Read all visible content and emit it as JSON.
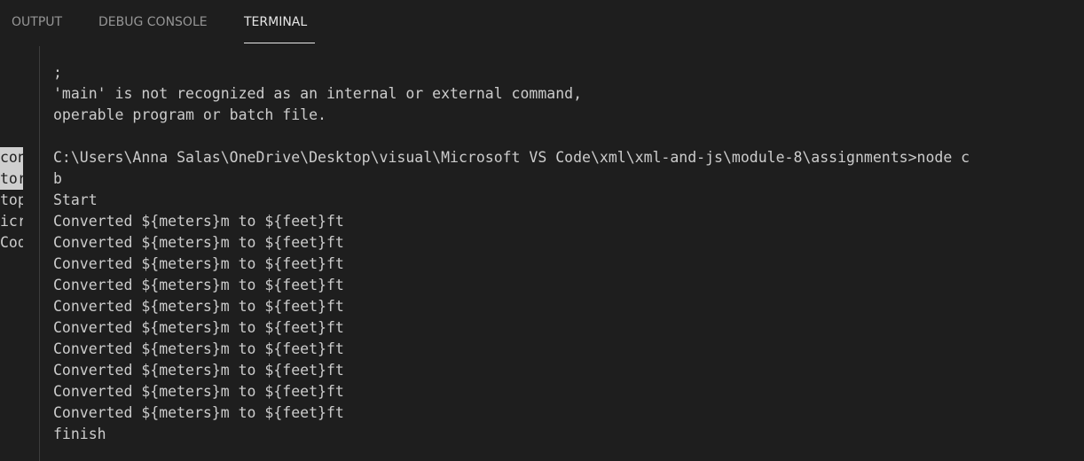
{
  "tabs": [
    {
      "label": "OUTPUT",
      "active": false
    },
    {
      "label": "DEBUG CONSOLE",
      "active": false
    },
    {
      "label": "TERMINAL",
      "active": true
    }
  ],
  "left_fragments": [
    "con",
    "tor",
    "top",
    "icr",
    "Cod"
  ],
  "terminal": {
    "lines": [
      ";",
      "'main' is not recognized as an internal or external command,",
      "operable program or batch file.",
      "",
      "C:\\Users\\Anna Salas\\OneDrive\\Desktop\\visual\\Microsoft VS Code\\xml\\xml-and-js\\module-8\\assignments>node c",
      "b",
      "Start",
      "Converted ${meters}m to ${feet}ft",
      "Converted ${meters}m to ${feet}ft",
      "Converted ${meters}m to ${feet}ft",
      "Converted ${meters}m to ${feet}ft",
      "Converted ${meters}m to ${feet}ft",
      "Converted ${meters}m to ${feet}ft",
      "Converted ${meters}m to ${feet}ft",
      "Converted ${meters}m to ${feet}ft",
      "Converted ${meters}m to ${feet}ft",
      "Converted ${meters}m to ${feet}ft",
      "finish"
    ]
  },
  "colors": {
    "background": "#1e1e1e",
    "text": "#cccccc",
    "tab_inactive": "#969696",
    "tab_active": "#e7e7e7"
  }
}
